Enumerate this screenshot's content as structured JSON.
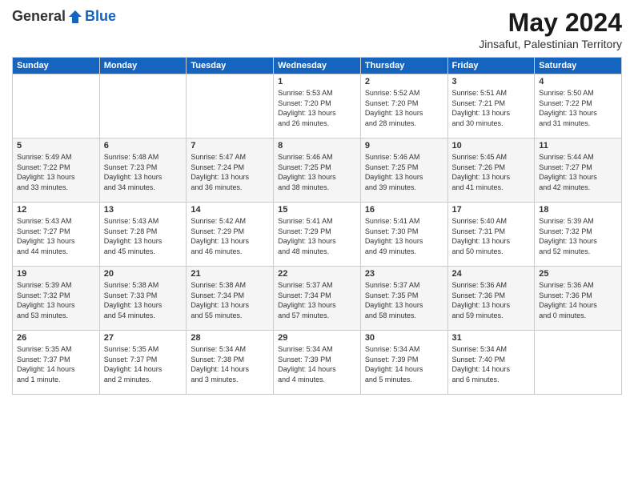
{
  "header": {
    "logo_general": "General",
    "logo_blue": "Blue",
    "month_title": "May 2024",
    "location": "Jinsafut, Palestinian Territory"
  },
  "days_of_week": [
    "Sunday",
    "Monday",
    "Tuesday",
    "Wednesday",
    "Thursday",
    "Friday",
    "Saturday"
  ],
  "weeks": [
    [
      {
        "day": "",
        "info": ""
      },
      {
        "day": "",
        "info": ""
      },
      {
        "day": "",
        "info": ""
      },
      {
        "day": "1",
        "info": "Sunrise: 5:53 AM\nSunset: 7:20 PM\nDaylight: 13 hours\nand 26 minutes."
      },
      {
        "day": "2",
        "info": "Sunrise: 5:52 AM\nSunset: 7:20 PM\nDaylight: 13 hours\nand 28 minutes."
      },
      {
        "day": "3",
        "info": "Sunrise: 5:51 AM\nSunset: 7:21 PM\nDaylight: 13 hours\nand 30 minutes."
      },
      {
        "day": "4",
        "info": "Sunrise: 5:50 AM\nSunset: 7:22 PM\nDaylight: 13 hours\nand 31 minutes."
      }
    ],
    [
      {
        "day": "5",
        "info": "Sunrise: 5:49 AM\nSunset: 7:22 PM\nDaylight: 13 hours\nand 33 minutes."
      },
      {
        "day": "6",
        "info": "Sunrise: 5:48 AM\nSunset: 7:23 PM\nDaylight: 13 hours\nand 34 minutes."
      },
      {
        "day": "7",
        "info": "Sunrise: 5:47 AM\nSunset: 7:24 PM\nDaylight: 13 hours\nand 36 minutes."
      },
      {
        "day": "8",
        "info": "Sunrise: 5:46 AM\nSunset: 7:25 PM\nDaylight: 13 hours\nand 38 minutes."
      },
      {
        "day": "9",
        "info": "Sunrise: 5:46 AM\nSunset: 7:25 PM\nDaylight: 13 hours\nand 39 minutes."
      },
      {
        "day": "10",
        "info": "Sunrise: 5:45 AM\nSunset: 7:26 PM\nDaylight: 13 hours\nand 41 minutes."
      },
      {
        "day": "11",
        "info": "Sunrise: 5:44 AM\nSunset: 7:27 PM\nDaylight: 13 hours\nand 42 minutes."
      }
    ],
    [
      {
        "day": "12",
        "info": "Sunrise: 5:43 AM\nSunset: 7:27 PM\nDaylight: 13 hours\nand 44 minutes."
      },
      {
        "day": "13",
        "info": "Sunrise: 5:43 AM\nSunset: 7:28 PM\nDaylight: 13 hours\nand 45 minutes."
      },
      {
        "day": "14",
        "info": "Sunrise: 5:42 AM\nSunset: 7:29 PM\nDaylight: 13 hours\nand 46 minutes."
      },
      {
        "day": "15",
        "info": "Sunrise: 5:41 AM\nSunset: 7:29 PM\nDaylight: 13 hours\nand 48 minutes."
      },
      {
        "day": "16",
        "info": "Sunrise: 5:41 AM\nSunset: 7:30 PM\nDaylight: 13 hours\nand 49 minutes."
      },
      {
        "day": "17",
        "info": "Sunrise: 5:40 AM\nSunset: 7:31 PM\nDaylight: 13 hours\nand 50 minutes."
      },
      {
        "day": "18",
        "info": "Sunrise: 5:39 AM\nSunset: 7:32 PM\nDaylight: 13 hours\nand 52 minutes."
      }
    ],
    [
      {
        "day": "19",
        "info": "Sunrise: 5:39 AM\nSunset: 7:32 PM\nDaylight: 13 hours\nand 53 minutes."
      },
      {
        "day": "20",
        "info": "Sunrise: 5:38 AM\nSunset: 7:33 PM\nDaylight: 13 hours\nand 54 minutes."
      },
      {
        "day": "21",
        "info": "Sunrise: 5:38 AM\nSunset: 7:34 PM\nDaylight: 13 hours\nand 55 minutes."
      },
      {
        "day": "22",
        "info": "Sunrise: 5:37 AM\nSunset: 7:34 PM\nDaylight: 13 hours\nand 57 minutes."
      },
      {
        "day": "23",
        "info": "Sunrise: 5:37 AM\nSunset: 7:35 PM\nDaylight: 13 hours\nand 58 minutes."
      },
      {
        "day": "24",
        "info": "Sunrise: 5:36 AM\nSunset: 7:36 PM\nDaylight: 13 hours\nand 59 minutes."
      },
      {
        "day": "25",
        "info": "Sunrise: 5:36 AM\nSunset: 7:36 PM\nDaylight: 14 hours\nand 0 minutes."
      }
    ],
    [
      {
        "day": "26",
        "info": "Sunrise: 5:35 AM\nSunset: 7:37 PM\nDaylight: 14 hours\nand 1 minute."
      },
      {
        "day": "27",
        "info": "Sunrise: 5:35 AM\nSunset: 7:37 PM\nDaylight: 14 hours\nand 2 minutes."
      },
      {
        "day": "28",
        "info": "Sunrise: 5:34 AM\nSunset: 7:38 PM\nDaylight: 14 hours\nand 3 minutes."
      },
      {
        "day": "29",
        "info": "Sunrise: 5:34 AM\nSunset: 7:39 PM\nDaylight: 14 hours\nand 4 minutes."
      },
      {
        "day": "30",
        "info": "Sunrise: 5:34 AM\nSunset: 7:39 PM\nDaylight: 14 hours\nand 5 minutes."
      },
      {
        "day": "31",
        "info": "Sunrise: 5:34 AM\nSunset: 7:40 PM\nDaylight: 14 hours\nand 6 minutes."
      },
      {
        "day": "",
        "info": ""
      }
    ]
  ]
}
